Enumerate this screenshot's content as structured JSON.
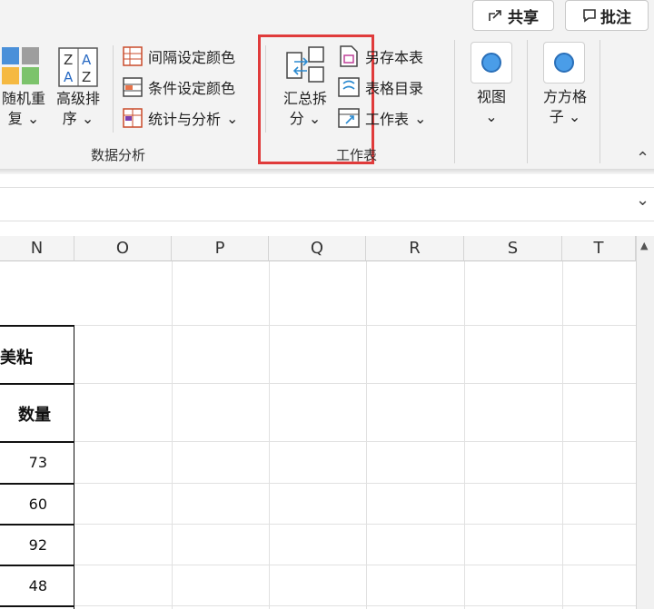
{
  "top_buttons": {
    "share": "共享",
    "comment": "批注"
  },
  "ribbon": {
    "random_dup": {
      "line1": "随机重",
      "line2": "复",
      "chev": "⌄"
    },
    "adv_sort": {
      "line1": "高级排",
      "line2": "序",
      "chev": "⌄"
    },
    "color_items": [
      "间隔设定颜色",
      "条件设定颜色",
      "统计与分析"
    ],
    "stats_chev": "⌄",
    "group_data_analysis": "数据分析",
    "summary_split": {
      "line1": "汇总拆",
      "line2": "分",
      "chev": "⌄"
    },
    "sheet_items": [
      "另存本表",
      "表格目录",
      "工作表"
    ],
    "sheet_chev": "⌄",
    "group_sheet": "工作表",
    "view": {
      "label": "视图",
      "chev": "⌄"
    },
    "grid_fangfang": {
      "line1": "方方格",
      "line2": "子",
      "chev": "⌄"
    },
    "collapse_chev": "⌃",
    "formula_chev": "⌄",
    "highlight_color": "#e03b3b"
  },
  "columns": [
    "N",
    "O",
    "P",
    "Q",
    "R",
    "S",
    "T"
  ],
  "cells": {
    "header_fragment": "美粘",
    "qty_header": "数量",
    "qty_values": [
      "73",
      "60",
      "92",
      "48"
    ]
  },
  "scroll_up": "▲"
}
